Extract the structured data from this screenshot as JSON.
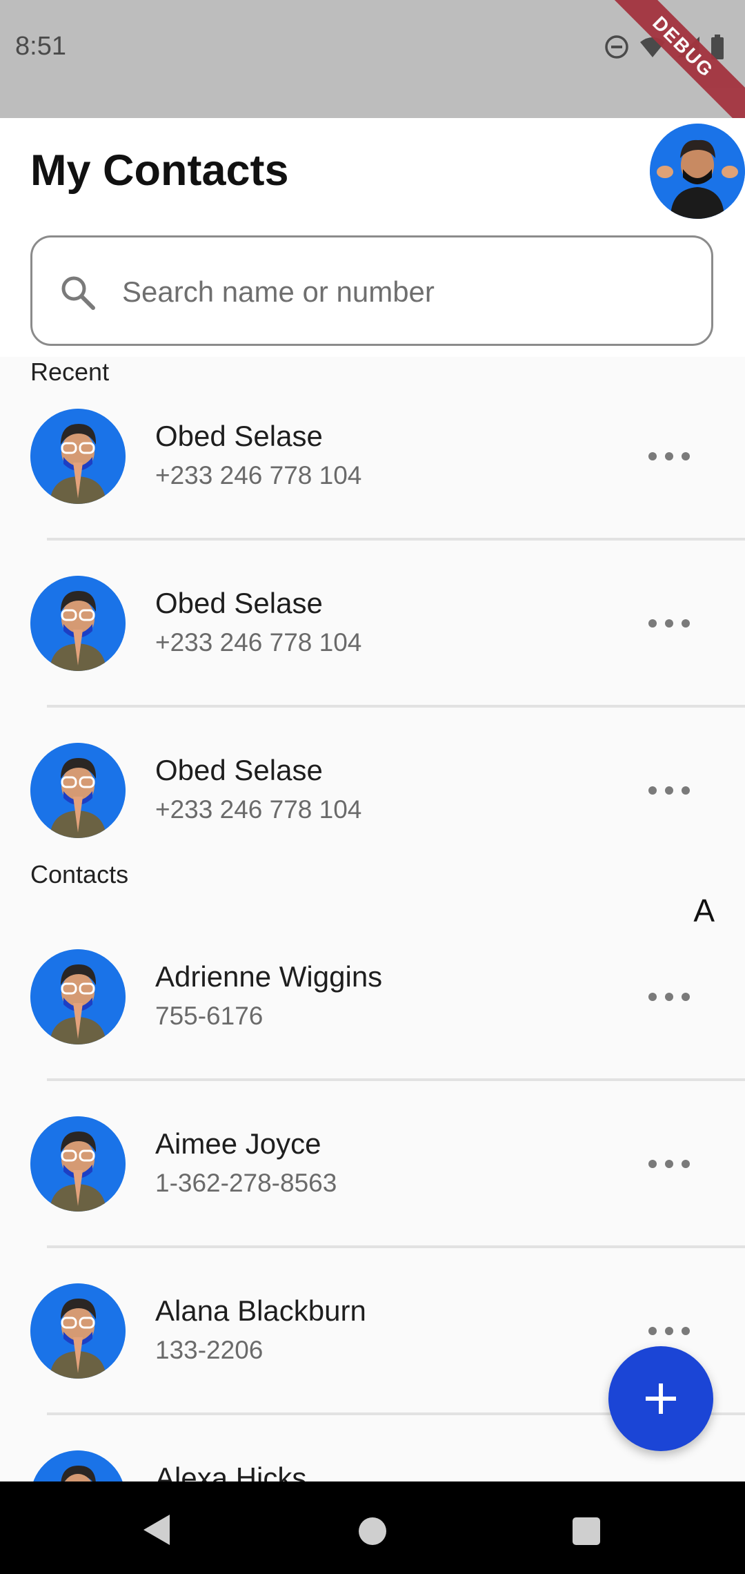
{
  "status_bar": {
    "time": "8:51",
    "debug_label": "DEBUG"
  },
  "header": {
    "title": "My Contacts",
    "search_placeholder": "Search name or number"
  },
  "sections": {
    "recent_label": "Recent",
    "contacts_label": "Contacts",
    "letter_index": "A"
  },
  "recent": [
    {
      "name": "Obed Selase",
      "phone": "+233 246 778 104"
    },
    {
      "name": "Obed Selase",
      "phone": "+233 246 778 104"
    },
    {
      "name": "Obed Selase",
      "phone": "+233 246 778 104"
    }
  ],
  "contacts": [
    {
      "name": "Adrienne Wiggins",
      "phone": "755-6176"
    },
    {
      "name": "Aimee Joyce",
      "phone": "1-362-278-8563"
    },
    {
      "name": "Alana Blackburn",
      "phone": "133-2206"
    },
    {
      "name": "Alexa Hicks",
      "phone": ""
    }
  ],
  "colors": {
    "accent": "#1b45d6",
    "avatar_bg": "#1a73e8",
    "status_bar": "#bdbdbd",
    "debug_banner": "#a3343f"
  },
  "icons": {
    "search": "search-icon",
    "more": "more-horizontal-icon",
    "add": "plus-icon",
    "back": "back-triangle-icon",
    "home": "home-circle-icon",
    "recents": "recents-square-icon"
  }
}
